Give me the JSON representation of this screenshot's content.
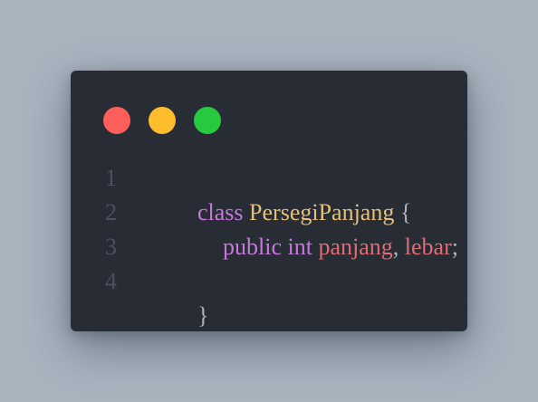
{
  "colors": {
    "background": "#a9b4bf",
    "window": "#282c35",
    "close": "#ff5f5a",
    "minimize": "#ffbd2e",
    "maximize": "#27c93f",
    "keyword": "#c678dd",
    "class_name": "#e5c07b",
    "punctuation": "#abb2bf",
    "identifier": "#e06c75",
    "line_number": "#4b5160"
  },
  "window_controls": {
    "close_icon": "red-circle",
    "minimize_icon": "yellow-circle",
    "maximize_icon": "green-circle"
  },
  "code": {
    "lines": [
      {
        "number": "1",
        "tokens": [
          {
            "text": "class",
            "kind": "keyword"
          },
          {
            "text": " ",
            "kind": "punctuation"
          },
          {
            "text": "PersegiPanjang",
            "kind": "class_name"
          },
          {
            "text": " {",
            "kind": "punctuation"
          }
        ]
      },
      {
        "number": "2",
        "indent": 1,
        "tokens": [
          {
            "text": "public",
            "kind": "keyword"
          },
          {
            "text": " ",
            "kind": "punctuation"
          },
          {
            "text": "int",
            "kind": "keyword"
          },
          {
            "text": " ",
            "kind": "punctuation"
          },
          {
            "text": "panjang",
            "kind": "identifier"
          },
          {
            "text": ", ",
            "kind": "punctuation"
          },
          {
            "text": "lebar",
            "kind": "identifier"
          },
          {
            "text": ";",
            "kind": "punctuation"
          }
        ]
      },
      {
        "number": "3",
        "tokens": []
      },
      {
        "number": "4",
        "tokens": [
          {
            "text": "}",
            "kind": "punctuation"
          }
        ]
      }
    ]
  }
}
